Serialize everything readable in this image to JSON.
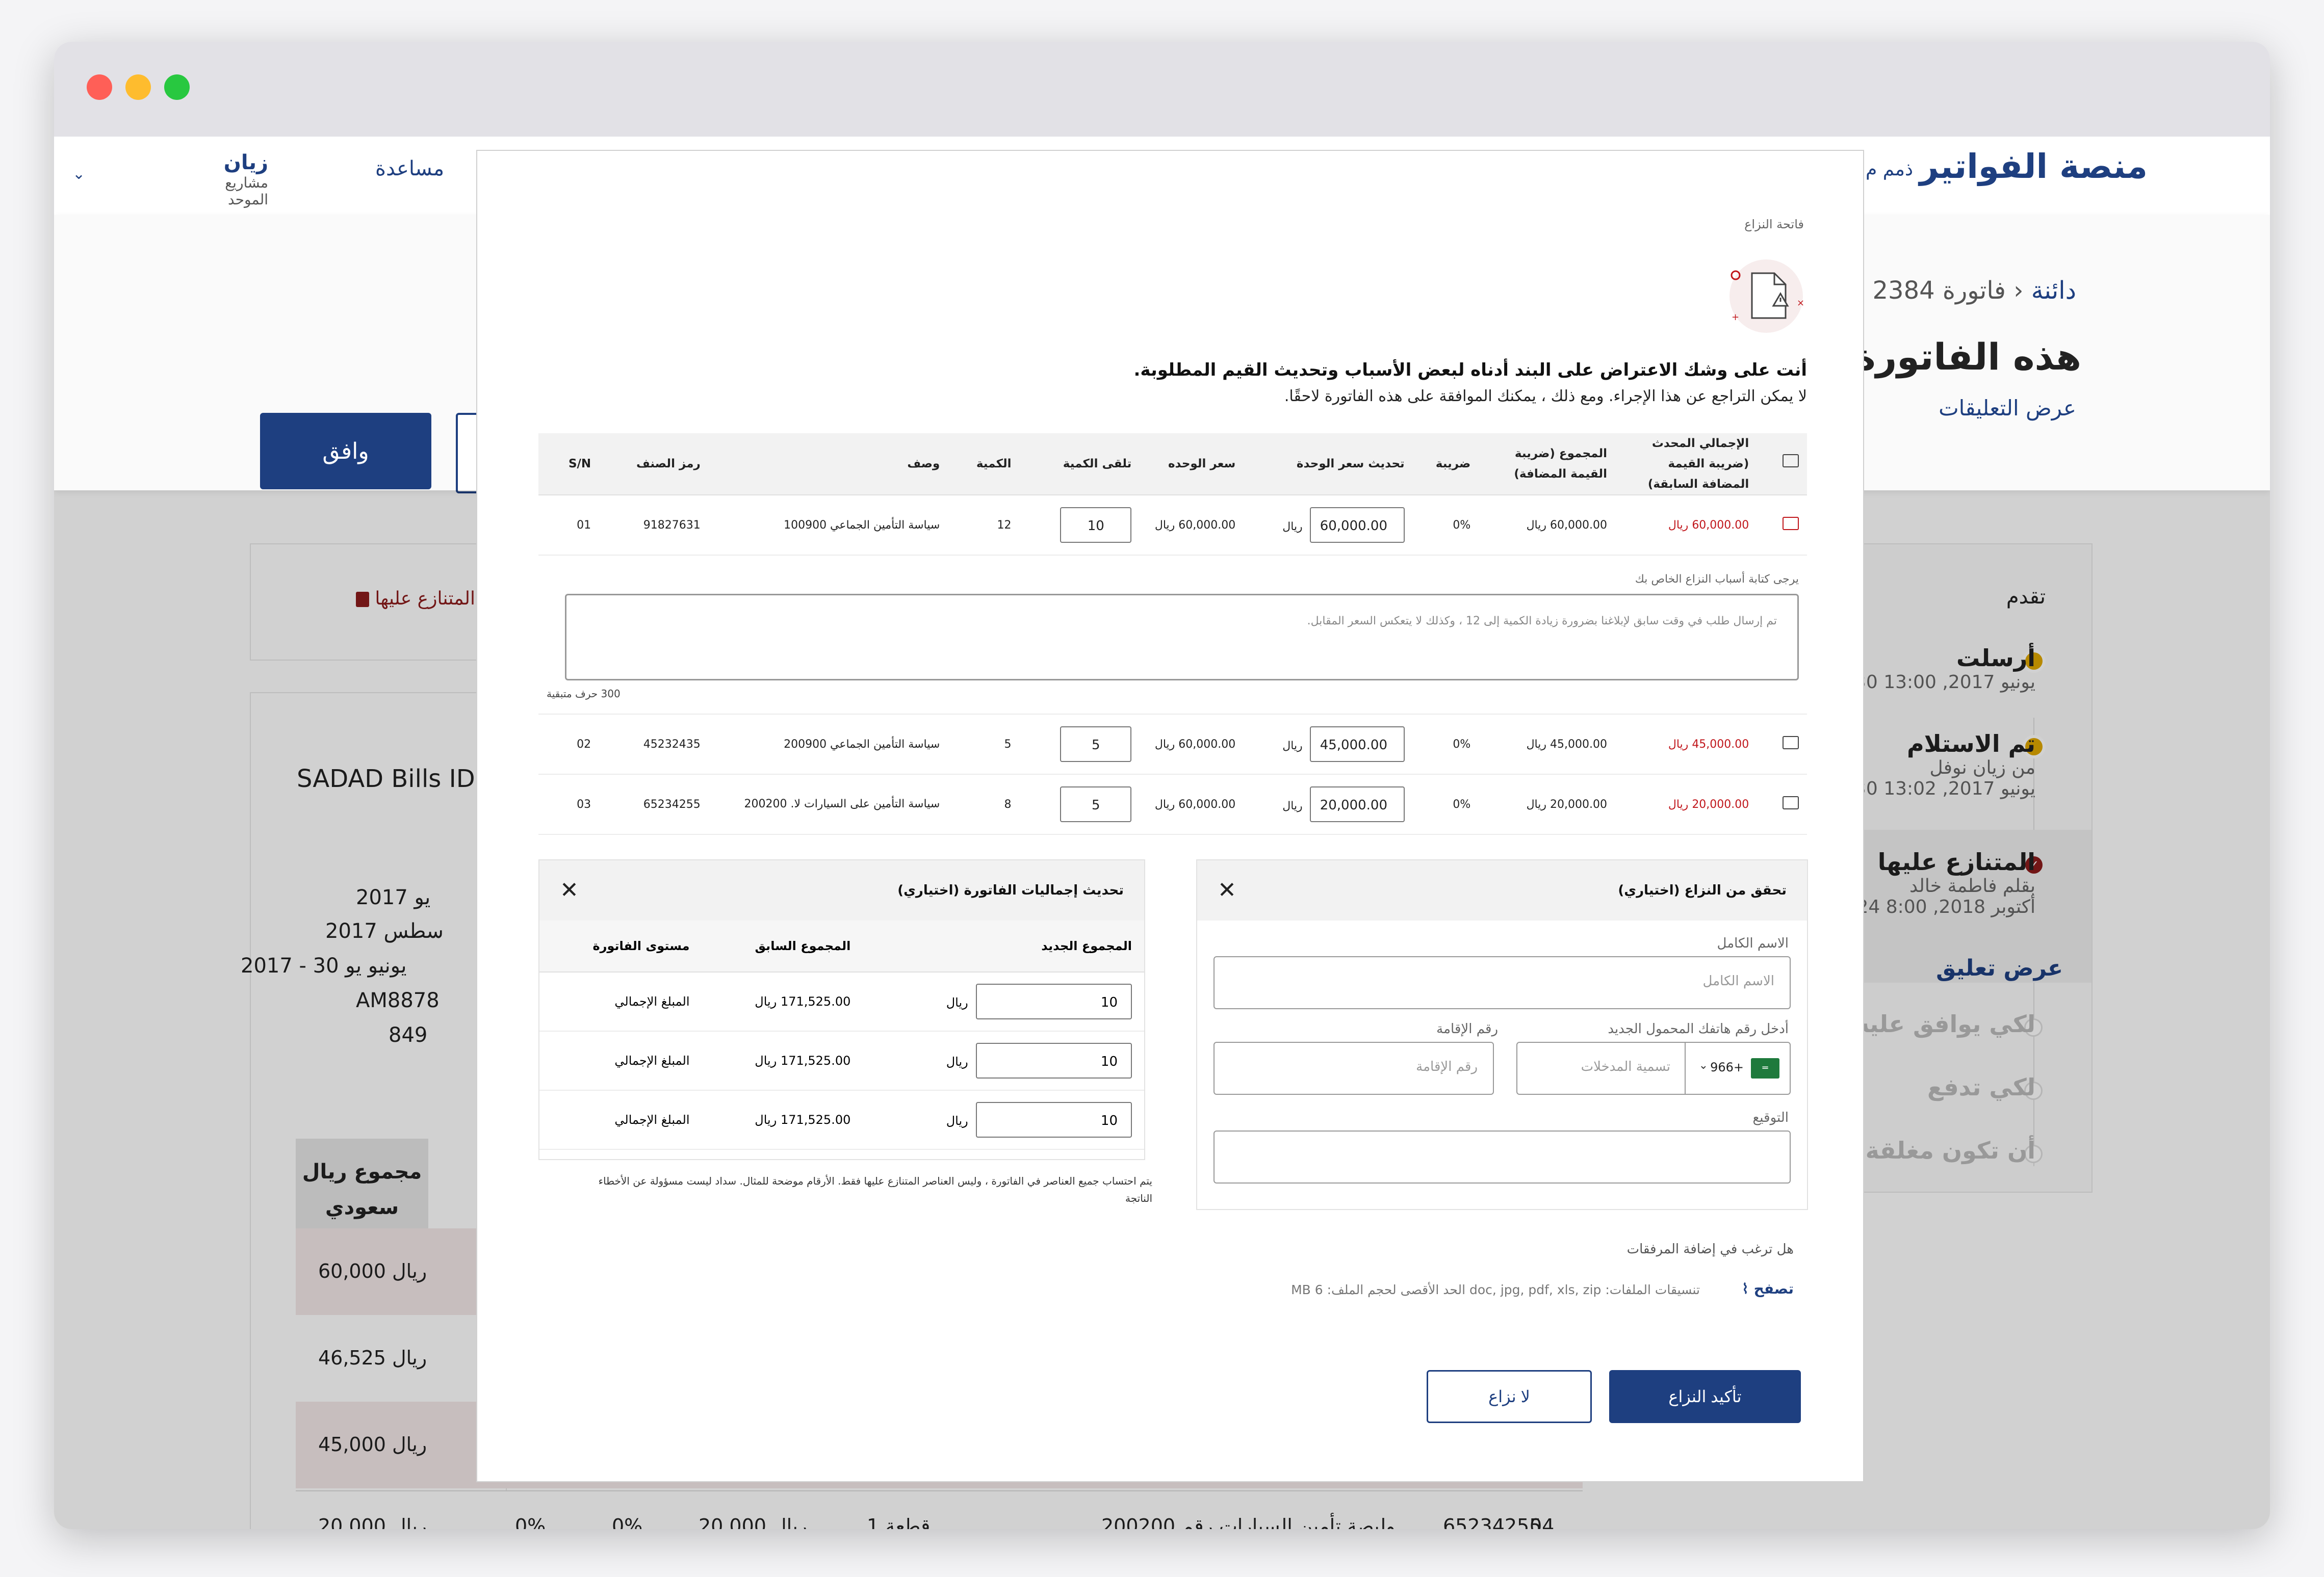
{
  "window": {
    "controls": [
      "close",
      "minimize",
      "maximize"
    ]
  },
  "header": {
    "brand": "منصة الفواتير",
    "nav_partial": "ذمم م",
    "help": "مساعدة",
    "user_name": "زيان",
    "user_sub": "مشاريع الموحد"
  },
  "page": {
    "crumb_root": "دائنة",
    "crumb_invoice": "فاتورة 2384",
    "title": "هذه الفاتورة م",
    "view_comments": "عرض التعليقات",
    "approve_label": "وافق"
  },
  "left": {
    "disputed_tag": "المتنازع عليها",
    "sadad": "SADAD Bills ID: ",
    "side_values": [
      "2017 يو",
      "2017 سطس",
      "2017 - 30 يونيو يو",
      "AM8878",
      "849"
    ]
  },
  "bg_table": {
    "header": "مجموع ريال سعودي",
    "rows": [
      "60,000 ريال",
      "46,525 ريال",
      "45,000 ريال"
    ],
    "last_row": [
      "ريال 20,000",
      "0%",
      "0%",
      "ريال 20,000",
      "1 قطعة",
      "وليصة تأمين السيارات رقم 200200",
      "65234255",
      "04"
    ]
  },
  "progress": {
    "title": "تقدم",
    "steps": [
      {
        "title": "أرسلت",
        "date": "30 يونيو 2017, 13:00",
        "status": "done"
      },
      {
        "title": "تم الاستلام",
        "by": "من زيان نوفل",
        "date": "30 يونيو 2017, 13:02",
        "status": "done"
      },
      {
        "title": "المتنازع عليها",
        "by": "بقلم فاطمة خالد",
        "date": "24 أكتوبر 2018, 8:00",
        "link": "عرض تعليق",
        "status": "disputed"
      },
      {
        "title": "لكي يوافق عليه",
        "status": "pending"
      },
      {
        "title": "لكي تدفع",
        "status": "pending"
      },
      {
        "title": "أن تكون مغلقة",
        "status": "pending"
      }
    ]
  },
  "modal": {
    "label": "فاتحة النزاع",
    "heading": "أنت على وشك الاعتراض على البند أدناه لبعض الأسباب وتحديث القيم المطلوبة.",
    "sub": "لا يمكن التراجع عن هذا الإجراء. ومع ذلك ، يمكنك الموافقة على هذه الفاتورة لاحقًا.",
    "columns": [
      "S/N",
      "رمز الصنف",
      "وصف",
      "الكمية",
      "تلقى الكمية",
      "سعر الوحده",
      "تحديث سعر الوحدة",
      "ضريبة",
      "المجموع (ضريبة القيمة المضافة)",
      "الإجمالي المحدث (ضريبة القيمة المضافة السابقة)"
    ],
    "rows": [
      {
        "sn": "01",
        "code": "91827631",
        "desc": "سياسة التأمين الجماعي 100900",
        "qty": "12",
        "recv": "10",
        "price": "60,000.00 ريال",
        "cur": "ريال",
        "newprice": "60,000.00",
        "tax": "0%",
        "total": "60,000.00 ريال",
        "updated": "60,000.00 ريال"
      },
      {
        "sn": "02",
        "code": "45232435",
        "desc": "سياسة التأمين الجماعي 200900",
        "qty": "5",
        "recv": "5",
        "price": "60,000.00 ريال",
        "cur": "ريال",
        "newprice": "45,000.00",
        "tax": "0%",
        "total": "45,000.00 ريال",
        "updated": "45,000.00 ريال"
      },
      {
        "sn": "03",
        "code": "65234255",
        "desc": "سياسة التأمين على السيارات لا. 200200",
        "qty": "8",
        "recv": "5",
        "price": "60,000.00 ريال",
        "cur": "ريال",
        "newprice": "20,000.00",
        "tax": "0%",
        "total": "20,000.00 ريال",
        "updated": "20,000.00 ريال"
      }
    ],
    "reason": {
      "label": "يرجى كتابة أسباب النزاع الخاص بك",
      "value": "تم إرسال طلب في وقت سابق لإبلاغنا بضرورة زيادة الكمية إلى 12 ، وكذلك لا يتعكس السعر المقابل.",
      "remaining": "300 حرف متبقية"
    },
    "totals": {
      "title": "تحديث إجماليات الفاتورة (اختياري)",
      "columns": [
        "المجموع الجديد",
        "المجموع السابق",
        "مستوى الفاتورة"
      ],
      "cur": "ريال",
      "rows": [
        {
          "new": "10",
          "prev": "171,525.00 ريال",
          "level": "المبلغ الإجمالي"
        },
        {
          "new": "10",
          "prev": "171,525.00 ريال",
          "level": "المبلغ الإجمالي"
        },
        {
          "new": "10",
          "prev": "171,525.00 ريال",
          "level": "المبلغ الإجمالي"
        }
      ],
      "note": "يتم احتساب جميع العناصر في الفاتورة ، وليس العناصر المتنازع عليها فقط. الأرقام موضحة للمثال. سداد ليست مسؤولة عن الأخطاء الناتجة"
    },
    "verify": {
      "title": "تحقق من النزاع (اختياري)",
      "name_label": "الاسم الكامل",
      "name_placeholder": "الاسم الكامل",
      "phone_label": "أدخل رقم هاتفك المحمول الجديد",
      "country_code": "+966",
      "phone_placeholder": "تسمية المدخلات",
      "id_label": "رقم الإقامة",
      "id_placeholder": "رقم الإقامة",
      "sign_label": "التوقيع"
    },
    "attach": {
      "question": "هل ترغب في إضافة المرفقات",
      "browse": "تصفح",
      "note": "تنسيقات الملفات: doc, jpg, pdf, xls, zip الحد الأقصى لحجم الملف: 6 MB"
    },
    "confirm": "تأكيد النزاع",
    "no": "لا نزاع"
  },
  "colors": {
    "brand": "#1e3f80",
    "danger": "#c0161b",
    "pending": "#e0a800",
    "disputed": "#8b1c1c"
  }
}
